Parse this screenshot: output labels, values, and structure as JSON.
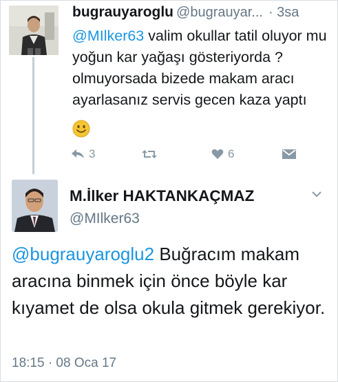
{
  "reply_tweet": {
    "display_name": "bugrauyaroglu",
    "handle": "@bugrauyar...",
    "time": "· 3sa",
    "mention": "@MIlker63",
    "text_after_mention": " valim okullar tatil oluyor mu yoğun kar yağaşı gösteriyorda ? olmuyorsada bizede makam aracı ayarlasanız servis gecen kaza yaptı",
    "emoji_icon": "smiley-face-icon",
    "actions": {
      "reply_count": "3",
      "retweet_count": "",
      "like_count": "6"
    }
  },
  "main_tweet": {
    "display_name": "M.İlker HAKTANKAÇMAZ",
    "handle": "@MIlker63",
    "mention": "@bugrauyaroglu2",
    "text_after_mention": " Buğracım makam aracına binmek için önce böyle kar kıyamet de olsa okula gitmek gerekiyor.",
    "timestamp": "18:15 · 08 Oca 17"
  },
  "colors": {
    "link": "#1b95e0",
    "secondary_text": "#657786",
    "icon_gray": "#8899a6",
    "thread_line": "#c4cdd5"
  }
}
